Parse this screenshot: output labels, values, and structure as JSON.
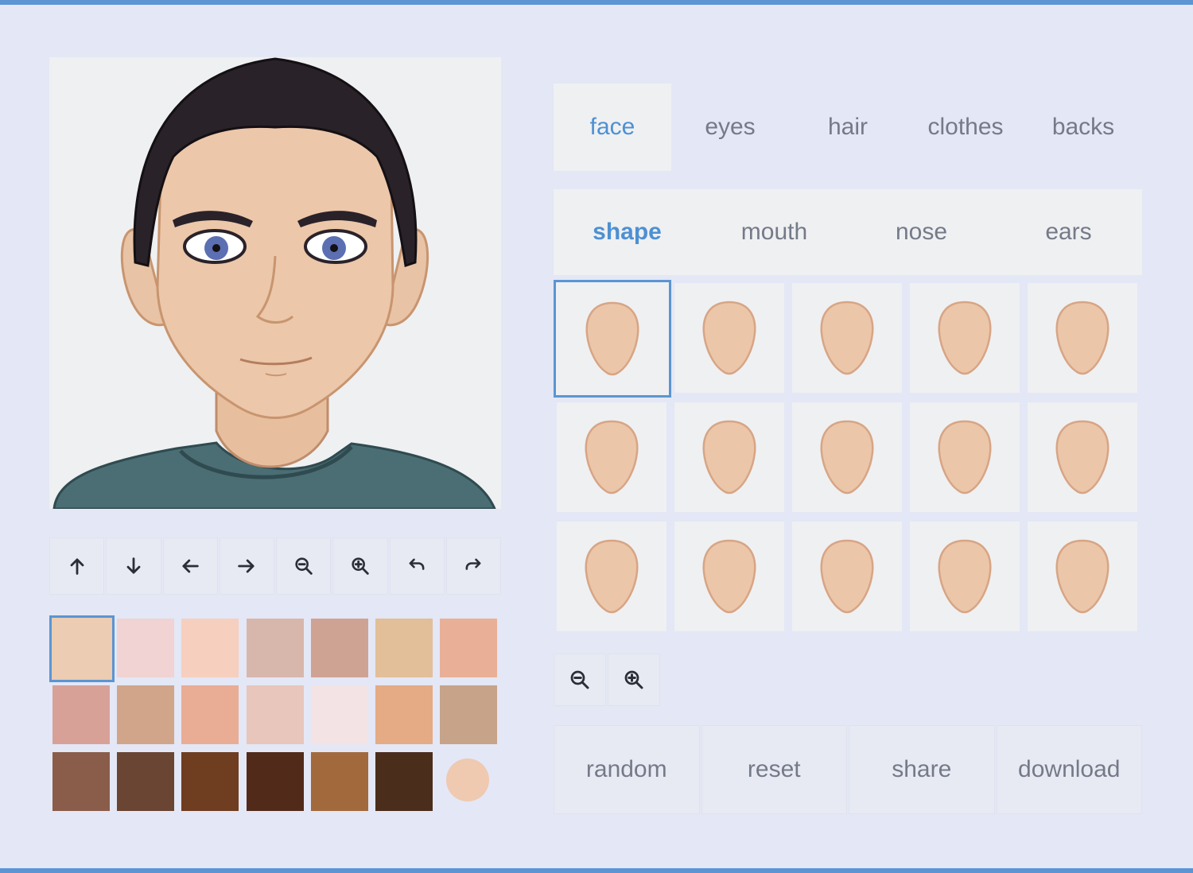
{
  "tabs": [
    {
      "label": "face",
      "active": true
    },
    {
      "label": "eyes",
      "active": false
    },
    {
      "label": "hair",
      "active": false
    },
    {
      "label": "clothes",
      "active": false
    },
    {
      "label": "backs",
      "active": false
    }
  ],
  "subtabs": [
    {
      "label": "shape",
      "active": true
    },
    {
      "label": "mouth",
      "active": false
    },
    {
      "label": "nose",
      "active": false
    },
    {
      "label": "ears",
      "active": false
    }
  ],
  "toolbar": [
    {
      "icon": "arrow-up-icon",
      "name": "move-up-button"
    },
    {
      "icon": "arrow-down-icon",
      "name": "move-down-button"
    },
    {
      "icon": "arrow-left-icon",
      "name": "move-left-button"
    },
    {
      "icon": "arrow-right-icon",
      "name": "move-right-button"
    },
    {
      "icon": "zoom-out-icon",
      "name": "zoom-out-button"
    },
    {
      "icon": "zoom-in-icon",
      "name": "zoom-in-button"
    },
    {
      "icon": "undo-icon",
      "name": "undo-button"
    },
    {
      "icon": "redo-icon",
      "name": "redo-button"
    }
  ],
  "skin_colors": {
    "selected_index": 0,
    "swatches": [
      "#ecccb2",
      "#f0d3d2",
      "#f6cfbe",
      "#d7b7ab",
      "#cfa394",
      "#e2bf99",
      "#e9b097",
      "#d7a198",
      "#d1a58a",
      "#e9ad95",
      "#e8c6bb",
      "#f3e3e4",
      "#e4ab84",
      "#c6a389",
      "#8a5d4a",
      "#6a4534",
      "#6f3d20",
      "#522a1a",
      "#a26a3c",
      "#4b2d1c"
    ],
    "custom_color": "#efc9b0"
  },
  "shape_grid": {
    "selected_index": 0,
    "count": 15,
    "face_fill": "#ecc6a9",
    "face_stroke": "#d7a585"
  },
  "shape_zoom": [
    {
      "icon": "zoom-out-icon",
      "name": "shape-zoom-out-button"
    },
    {
      "icon": "zoom-in-icon",
      "name": "shape-zoom-in-button"
    }
  ],
  "actions": {
    "random": "random",
    "reset": "reset",
    "share": "share",
    "download": "download"
  },
  "colors": {
    "accent": "#5b95d3",
    "tab_active": "#4e90d2",
    "text": "#757a88",
    "background": "#e4e7f5",
    "panel": "#eff0f2"
  }
}
